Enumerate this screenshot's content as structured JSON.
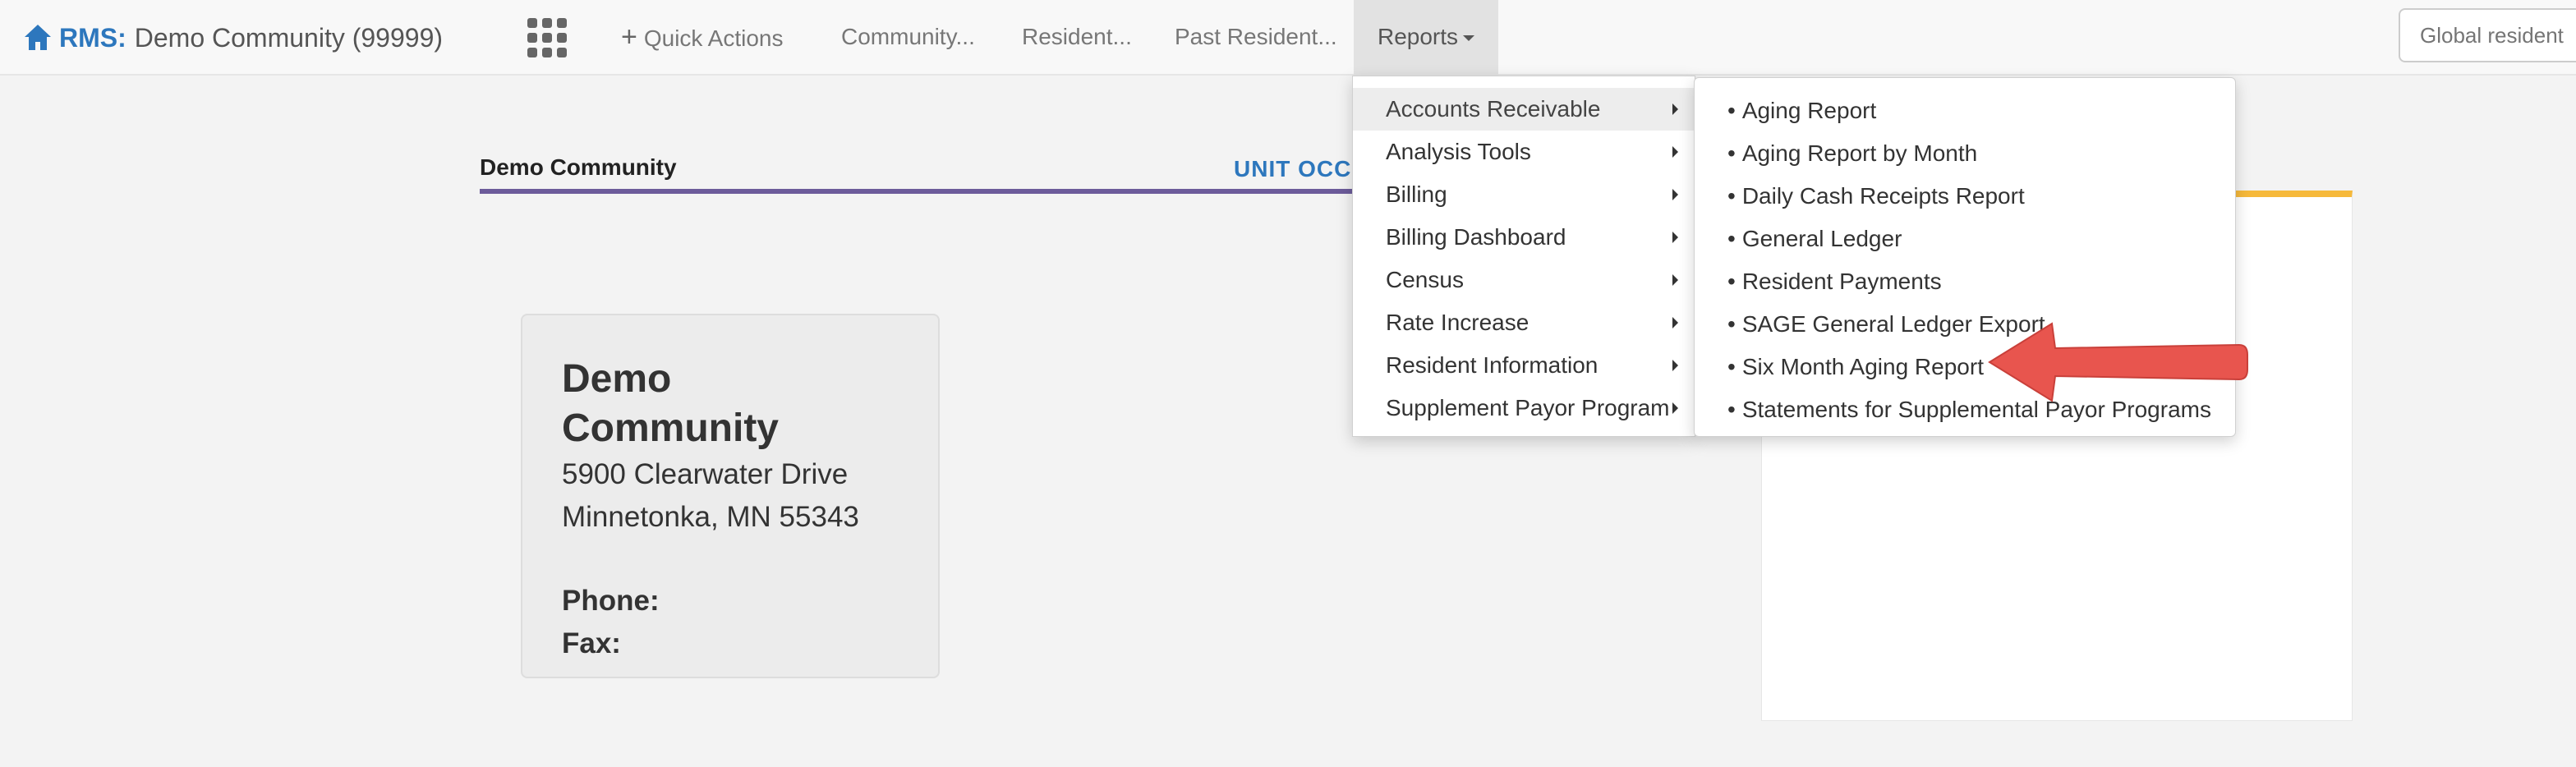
{
  "navbar": {
    "brand_prefix": "RMS:",
    "community_name": "Demo Community (99999)",
    "quick_actions": "Quick Actions",
    "community": "Community...",
    "resident": "Resident...",
    "past_resident": "Past Resident...",
    "reports": "Reports",
    "search_placeholder": "Global resident"
  },
  "page": {
    "section_title": "Demo Community",
    "tab_label": "UNIT OCCU",
    "card": {
      "name": "Demo Community",
      "address1": "5900 Clearwater Drive",
      "address2": "Minnetonka, MN 55343",
      "phone_label": "Phone:",
      "fax_label": "Fax:"
    }
  },
  "reports_menu": {
    "items": [
      {
        "label": "Accounts Receivable"
      },
      {
        "label": "Analysis Tools"
      },
      {
        "label": "Billing"
      },
      {
        "label": "Billing Dashboard"
      },
      {
        "label": "Census"
      },
      {
        "label": "Rate Increase"
      },
      {
        "label": "Resident Information"
      },
      {
        "label": "Supplement Payor Program"
      }
    ],
    "active_index": 0
  },
  "submenu": {
    "bullet": "•",
    "items": [
      {
        "label": "Aging Report"
      },
      {
        "label": "Aging Report by Month"
      },
      {
        "label": "Daily Cash Receipts Report"
      },
      {
        "label": "General Ledger"
      },
      {
        "label": "Resident Payments"
      },
      {
        "label": "SAGE General Ledger Export"
      },
      {
        "label": "Six Month Aging Report"
      },
      {
        "label": "Statements for Supplemental Payor Programs"
      }
    ]
  },
  "colors": {
    "brand_blue": "#2d77bd",
    "purple_rule": "#6c5b9a",
    "accent_yellow": "#f6b93b",
    "arrow_red": "#e8554e"
  },
  "icons": {
    "home": "home-icon",
    "apps": "apps-grid-icon",
    "plus": "plus-icon",
    "caret_down": "caret-down-icon",
    "caret_right": "caret-right-icon"
  }
}
